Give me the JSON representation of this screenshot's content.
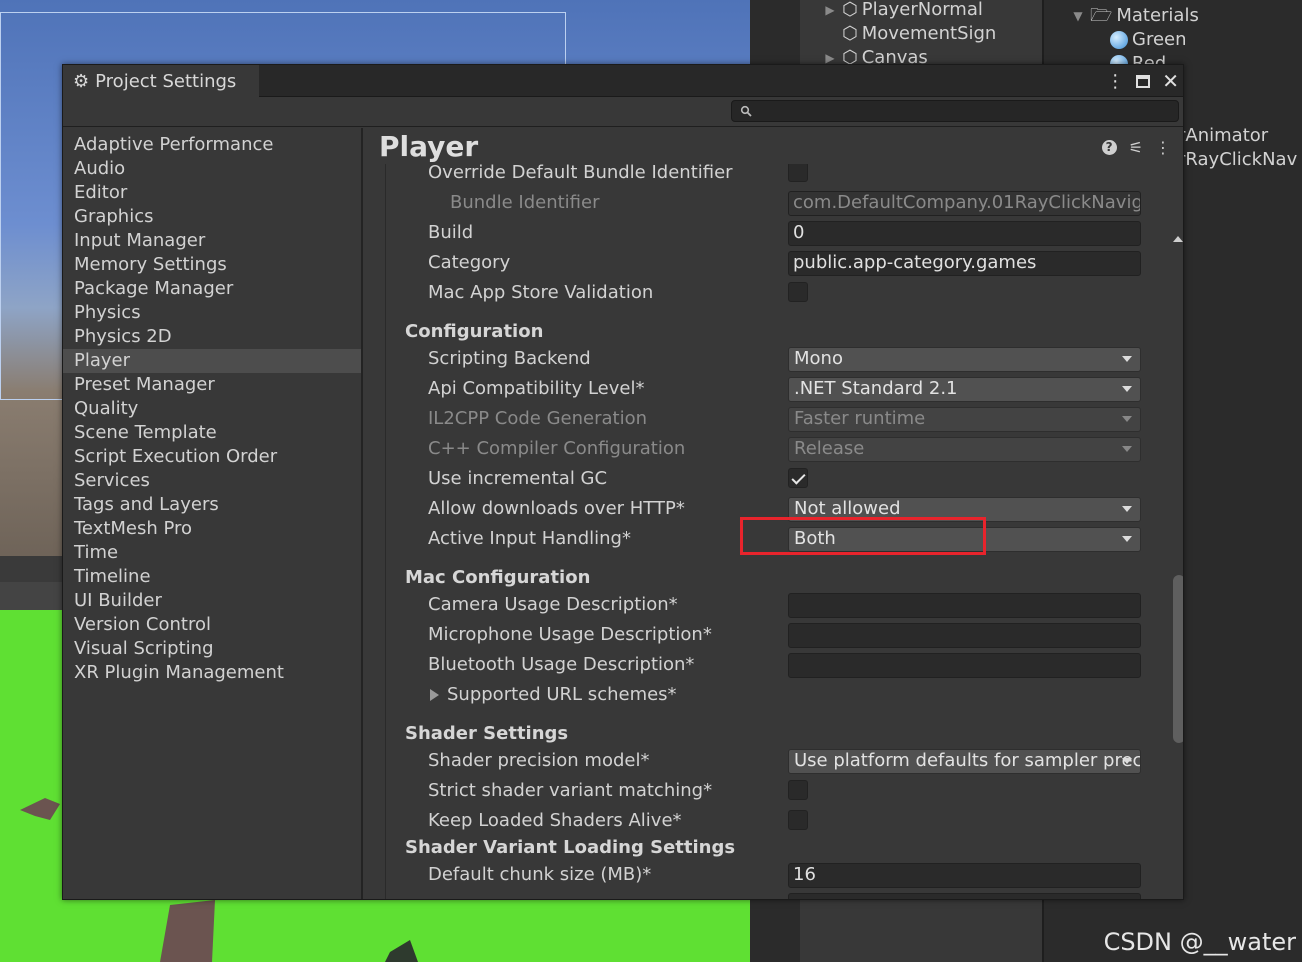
{
  "background": {
    "hierarchy_items": [
      "PlayerNormal",
      "MovementSign",
      "Canvas"
    ],
    "project_items": [
      {
        "label": "Materials",
        "icon": "folder-icon"
      },
      {
        "label": "Green",
        "icon": "material-sphere-icon"
      },
      {
        "label": "Red",
        "icon": "material-sphere-icon"
      }
    ],
    "side_fragments": [
      "rAnimator",
      "rRayClickNav"
    ],
    "watermark": "CSDN @__water"
  },
  "window": {
    "tab_title": "Project Settings",
    "search": {
      "value": "",
      "placeholder": ""
    }
  },
  "sidebar": {
    "items": [
      "Adaptive Performance",
      "Audio",
      "Editor",
      "Graphics",
      "Input Manager",
      "Memory Settings",
      "Package Manager",
      "Physics",
      "Physics 2D",
      "Player",
      "Preset Manager",
      "Quality",
      "Scene Template",
      "Script Execution Order",
      "Services",
      "Tags and Layers",
      "TextMesh Pro",
      "Time",
      "Timeline",
      "UI Builder",
      "Version Control",
      "Visual Scripting",
      "XR Plugin Management"
    ],
    "selected": "Player"
  },
  "player": {
    "title": "Player",
    "identification": {
      "override_bundle_label": "Override Default Bundle Identifier",
      "bundle_id_label": "Bundle Identifier",
      "bundle_id_value": "com.DefaultCompany.01RayClickNavig",
      "build_label": "Build",
      "build_value": "0",
      "category_label": "Category",
      "category_value": "public.app-category.games",
      "mac_store_label": "Mac App Store Validation"
    },
    "configuration": {
      "header": "Configuration",
      "scripting_backend_label": "Scripting Backend",
      "scripting_backend_value": "Mono",
      "api_label": "Api Compatibility Level*",
      "api_value": ".NET Standard 2.1",
      "il2cpp_label": "IL2CPP Code Generation",
      "il2cpp_value": "Faster runtime",
      "cpp_label": "C++ Compiler Configuration",
      "cpp_value": "Release",
      "incgc_label": "Use incremental GC",
      "http_label": "Allow downloads over HTTP*",
      "http_value": "Not allowed",
      "input_label": "Active Input Handling*",
      "input_value": "Both"
    },
    "mac_configuration": {
      "header": "Mac Configuration",
      "camera_label": "Camera Usage Description*",
      "camera_value": "",
      "mic_label": "Microphone Usage Description*",
      "mic_value": "",
      "bt_label": "Bluetooth Usage Description*",
      "bt_value": "",
      "url_label": "Supported URL schemes*"
    },
    "shader_settings": {
      "header": "Shader Settings",
      "precision_label": "Shader precision model*",
      "precision_value": "Use platform defaults for sampler prec",
      "strict_label": "Strict shader variant matching*",
      "keep_label": "Keep Loaded Shaders Alive*"
    },
    "shader_variant": {
      "header": "Shader Variant Loading Settings",
      "chunk_label": "Default chunk size (MB)*",
      "chunk_value": "16"
    }
  },
  "colors": {
    "highlight": "#e8242c",
    "panel": "#383838",
    "selected": "#4d4d4d"
  }
}
